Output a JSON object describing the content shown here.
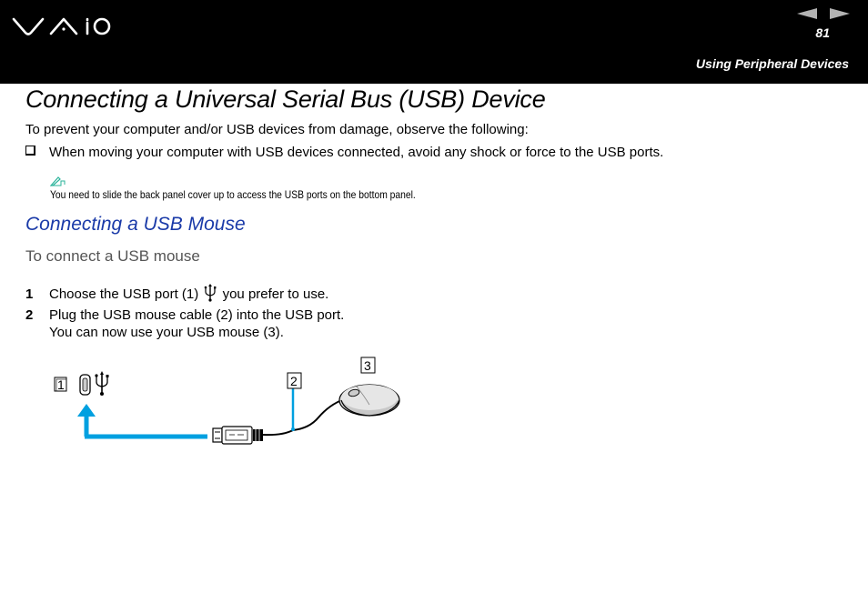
{
  "header": {
    "brand": "VAIO",
    "page_number": "81",
    "section": "Using Peripheral Devices",
    "nav": {
      "prev": "previous-page",
      "next": "next-page"
    },
    "colors": {
      "background": "#000000",
      "nav_arrow": "#b3b3b3",
      "text": "#ffffff"
    }
  },
  "content": {
    "title": "Connecting a Universal Serial Bus (USB) Device",
    "intro": "To prevent your computer and/or USB devices from damage, observe the following:",
    "bullets": [
      "When moving your computer with USB devices connected, avoid any shock or force to the USB ports."
    ],
    "note": "You need to slide the back panel cover up to access the USB ports on the bottom panel.",
    "subsection_title": "Connecting a USB Mouse",
    "procedure_title": "To connect a USB mouse",
    "steps": [
      {
        "number": "1",
        "text_before_icon": "Choose the USB port (1)",
        "text_after_icon": "you prefer to use."
      },
      {
        "number": "2",
        "text": "Plug the USB mouse cable (2) into the USB port.",
        "text_line2": "You can now use your USB mouse (3)."
      }
    ],
    "colors": {
      "subtitle": "#1a3aa8",
      "procedure_title": "#555555",
      "note_icon": "#2ab39a",
      "callout_line": "#00a0e0"
    }
  },
  "diagram": {
    "callouts": [
      "1",
      "2",
      "3"
    ],
    "parts": [
      "usb-port",
      "usb-symbol",
      "usb-plug",
      "mouse-cable",
      "usb-mouse"
    ]
  }
}
